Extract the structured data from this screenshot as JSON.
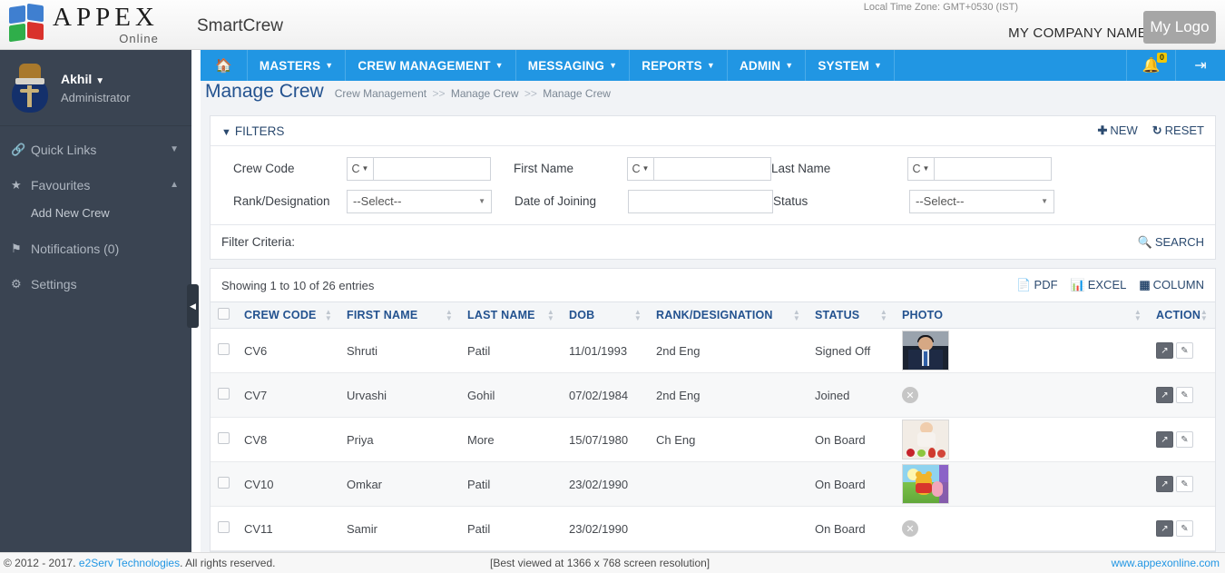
{
  "header": {
    "brand_main": "APPEX",
    "brand_sub": "Online",
    "app_name": "SmartCrew",
    "timezone": "Local Time Zone: GMT+0530 (IST)",
    "company": "MY COMPANY NAME",
    "logo_placeholder": "My Logo",
    "logo_icon": "cube-logo-icon"
  },
  "sidebar": {
    "user_name": "Akhil",
    "user_role": "Administrator",
    "avatar_icon": "emblem-avatar",
    "items": [
      {
        "label": "Quick Links",
        "icon": "link-icon",
        "chevron": "chevron-down-icon",
        "expanded": false
      },
      {
        "label": "Favourites",
        "icon": "star-icon",
        "chevron": "chevron-up-icon",
        "expanded": true
      },
      {
        "label": "Notifications (0)",
        "icon": "flag-icon",
        "chevron": "",
        "expanded": false
      },
      {
        "label": "Settings",
        "icon": "gears-icon",
        "chevron": "",
        "expanded": false
      }
    ],
    "favourites_children": [
      "Add New Crew"
    ],
    "collapse_handle_icon": "chevron-left-icon"
  },
  "mainnav": {
    "home_icon": "home-icon",
    "items": [
      {
        "label": "MASTERS",
        "caret": "▾"
      },
      {
        "label": "CREW MANAGEMENT",
        "caret": "▾"
      },
      {
        "label": "MESSAGING",
        "caret": "▾"
      },
      {
        "label": "REPORTS",
        "caret": "▾"
      },
      {
        "label": "ADMIN",
        "caret": "▾"
      },
      {
        "label": "SYSTEM",
        "caret": "▾"
      }
    ],
    "notification_icon": "bell-icon",
    "notification_count": "0",
    "logout_icon": "logout-icon"
  },
  "page": {
    "title": "Manage Crew",
    "breadcrumb": [
      "Crew Management",
      "Manage Crew",
      "Manage Crew"
    ],
    "breadcrumb_separator": ">>"
  },
  "filters": {
    "title": "FILTERS",
    "filter_icon": "funnel-icon",
    "new_label": "NEW",
    "new_icon": "plus-icon",
    "reset_label": "RESET",
    "reset_icon": "refresh-icon",
    "fields": {
      "crew_code": {
        "label": "Crew Code",
        "prefix": "C",
        "value": "",
        "placeholder": ""
      },
      "rank_designation": {
        "label": "Rank/Designation",
        "value": "--Select--"
      },
      "first_name": {
        "label": "First Name",
        "prefix": "C",
        "value": "",
        "placeholder": ""
      },
      "date_of_joining": {
        "label": "Date of Joining",
        "value": "",
        "placeholder": ""
      },
      "last_name": {
        "label": "Last Name",
        "prefix": "C",
        "value": "",
        "placeholder": ""
      },
      "status": {
        "label": "Status",
        "value": "--Select--"
      }
    },
    "criteria_label": "Filter Criteria:",
    "criteria_value": "",
    "search_label": "SEARCH",
    "search_icon": "search-icon"
  },
  "list": {
    "showing": "Showing 1 to 10 of 26 entries",
    "exports": [
      {
        "label": "PDF",
        "icon": "pdf-icon"
      },
      {
        "label": "EXCEL",
        "icon": "excel-icon"
      },
      {
        "label": "COLUMN",
        "icon": "grid-icon"
      }
    ],
    "columns": [
      "CREW CODE",
      "FIRST NAME",
      "LAST NAME",
      "DOB",
      "RANK/DESIGNATION",
      "STATUS",
      "PHOTO",
      "ACTION"
    ],
    "rows": [
      {
        "crew_code": "CV6",
        "first_name": "Shruti",
        "last_name": "Patil",
        "dob": "11/01/1993",
        "rank": "2nd Eng",
        "status": "Signed Off",
        "photo": "man-photo"
      },
      {
        "crew_code": "CV7",
        "first_name": "Urvashi",
        "last_name": "Gohil",
        "dob": "07/02/1984",
        "rank": "2nd Eng",
        "status": "Joined",
        "photo": "no-photo"
      },
      {
        "crew_code": "CV8",
        "first_name": "Priya",
        "last_name": "More",
        "dob": "15/07/1980",
        "rank": "Ch Eng",
        "status": "On Board",
        "photo": "baby-photo"
      },
      {
        "crew_code": "CV10",
        "first_name": "Omkar",
        "last_name": "Patil",
        "dob": "23/02/1990",
        "rank": "",
        "status": "On Board",
        "photo": "pooh-photo"
      },
      {
        "crew_code": "CV11",
        "first_name": "Samir",
        "last_name": "Patil",
        "dob": "23/02/1990",
        "rank": "",
        "status": "On Board",
        "photo": "no-photo"
      }
    ],
    "action_view_icon": "open-external-icon",
    "action_edit_icon": "pencil-icon"
  },
  "footer": {
    "copyright_prefix": "© 2012 - 2017. ",
    "company_link": "e2Serv Technologies",
    "copyright_suffix": ". All rights reserved.",
    "center": "[Best viewed at 1366 x 768 screen resolution]",
    "website": "www.appexonline.com"
  },
  "colors": {
    "nav_blue": "#2196e3",
    "sidebar_dark": "#3a4452",
    "title_blue": "#23528f",
    "badge_yellow": "#f0c808"
  }
}
